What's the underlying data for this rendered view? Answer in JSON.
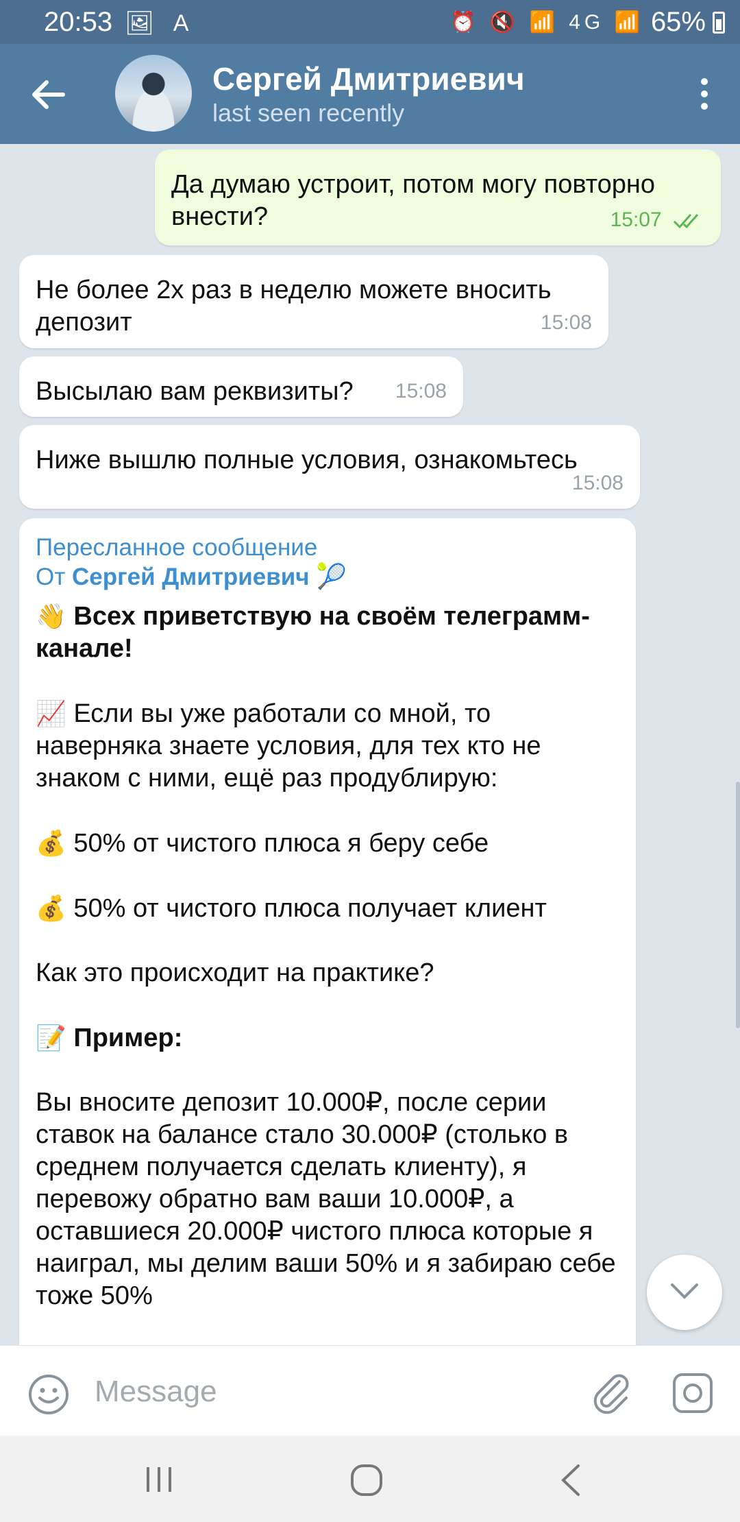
{
  "status_bar": {
    "time": "20:53",
    "left_icons": "🖼 A",
    "right_icons": "⏰ 🔇 📶 4G 📶",
    "battery": "65%"
  },
  "header": {
    "contact_name": "Сергей Дмитриевич",
    "contact_status": "last seen recently"
  },
  "messages": [
    {
      "direction": "out",
      "text": "Да думаю устроит, потом могу повторно внести?",
      "time": "15:07"
    },
    {
      "direction": "in",
      "text": "Не более 2х раз в неделю можете вносить депозит",
      "time": "15:08"
    },
    {
      "direction": "in",
      "text": "Высылаю вам реквизиты?",
      "time": "15:08"
    },
    {
      "direction": "in",
      "text": "Ниже вышлю полные условия, ознакомьтесь",
      "time": "15:08"
    }
  ],
  "forwarded": {
    "label": "Пересланное сообщение",
    "from_prefix": "От ",
    "from_name": "Сергей Дмитриевич",
    "from_emoji": "🎾",
    "greeting_emoji": "👋",
    "greeting": "Всех приветствую на своём телеграмм-канале!",
    "intro_emoji": "📈",
    "intro": "Если вы уже работали со мной, то наверняка знаете условия, для тех кто не знаком с ними, ещё раз продублирую:",
    "term1_emoji": "💰",
    "term1": "50% от чистого плюса я беру себе",
    "term2_emoji": "💰",
    "term2": "50% от чистого плюса получает клиент",
    "question": "Как это происходит на практике?",
    "example_emoji": "📝",
    "example_title": "Пример:",
    "example_text": "Вы вносите депозит 10.000₽, после серии ставок на балансе стало 30.000₽ (столько в среднем получается сделать клиенту), я перевожу обратно вам ваши 10.000₽, а оставшиеся 20.000₽ чистого плюса которые я наиграл, мы делим ваши 50% и я забираю себе тоже 50%"
  },
  "input": {
    "placeholder": "Message"
  }
}
